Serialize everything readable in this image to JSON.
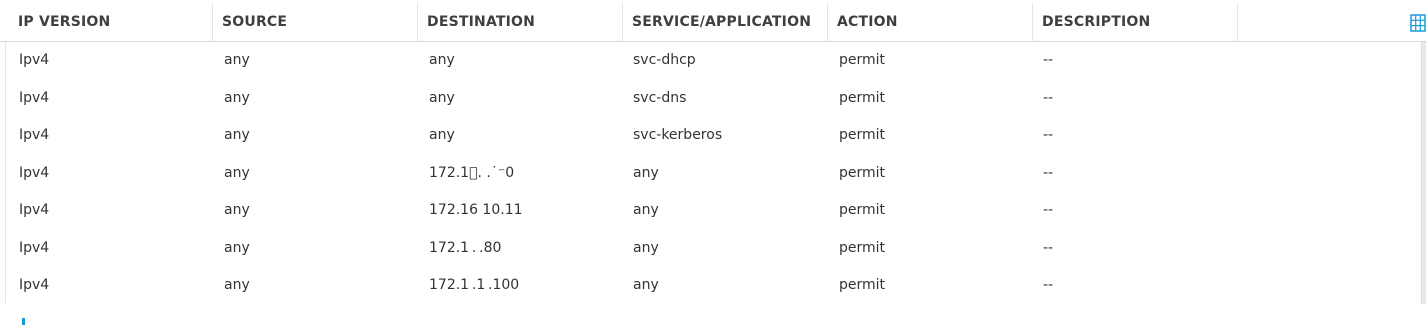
{
  "table": {
    "columns": [
      "IP VERSION",
      "SOURCE",
      "DESTINATION",
      "SERVICE/APPLICATION",
      "ACTION",
      "DESCRIPTION",
      ""
    ],
    "rows": [
      [
        "Ipv4",
        "any",
        "any",
        "svc-dhcp",
        "permit",
        "--"
      ],
      [
        "Ipv4",
        "any",
        "any",
        "svc-dns",
        "permit",
        "--"
      ],
      [
        "Ipv4",
        "any",
        "any",
        "svc-kerberos",
        "permit",
        "--"
      ],
      [
        "Ipv4",
        "any",
        "172.1\u0000.  .˙⁻0",
        "any",
        "permit",
        "--"
      ],
      [
        "Ipv4",
        "any",
        "172.16 10.11",
        "any",
        "permit",
        "--"
      ],
      [
        "Ipv4",
        "any",
        "172.1 . .80",
        "any",
        "permit",
        "--"
      ],
      [
        "Ipv4",
        "any",
        "172.1 .1 .100",
        "any",
        "permit",
        "--"
      ]
    ]
  },
  "icons": {
    "column_chooser": "grid-columns-icon",
    "add": "add-icon"
  },
  "colors": {
    "accent": "#1a9bd7",
    "header_text": "#3f3f3f",
    "cell_text": "#333333"
  }
}
